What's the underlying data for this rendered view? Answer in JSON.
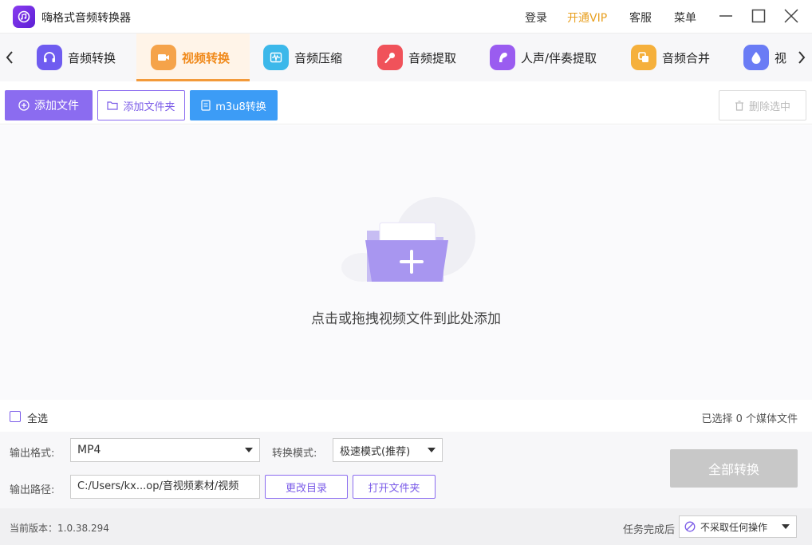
{
  "app": {
    "title": "嗨格式音频转换器",
    "login": "登录",
    "vip": "开通VIP",
    "service": "客服",
    "menu": "菜单"
  },
  "nav": {
    "tabs": [
      {
        "label": "音频转换",
        "icon": "headphones-icon",
        "color": "#6f5cf0"
      },
      {
        "label": "视频转换",
        "icon": "video-camera-icon",
        "color": "#f5a34a"
      },
      {
        "label": "音频压缩",
        "icon": "waveform-icon",
        "color": "#3cb8ea"
      },
      {
        "label": "音频提取",
        "icon": "microphone-icon",
        "color": "#f0525a"
      },
      {
        "label": "人声/伴奏提取",
        "icon": "voice-icon",
        "color": "#9a5cf0"
      },
      {
        "label": "音频合并",
        "icon": "merge-icon",
        "color": "#f5b03c"
      },
      {
        "label": "视",
        "icon": "drop-icon",
        "color": "#6a7cf5"
      }
    ]
  },
  "toolbar": {
    "add_file": "添加文件",
    "add_folder": "添加文件夹",
    "m3u8": "m3u8转换",
    "delete_selected": "删除选中"
  },
  "dropzone": {
    "hint": "点击或拖拽视频文件到此处添加"
  },
  "selection": {
    "select_all": "全选",
    "count_text": "已选择 0 个媒体文件"
  },
  "settings": {
    "format_label": "输出格式:",
    "format_value": "MP4",
    "mode_label": "转换模式:",
    "mode_value": "极速模式(推荐)",
    "path_label": "输出路径:",
    "path_value": "C:/Users/kx...op/音视频素材/视频",
    "change_dir": "更改目录",
    "open_folder": "打开文件夹",
    "convert_all": "全部转换"
  },
  "footer": {
    "version": "当前版本：1.0.38.294",
    "after_label": "任务完成后",
    "after_value": "不采取任何操作"
  },
  "colors": {
    "accent": "#8b6cf0",
    "active_tab": "#f08a1c",
    "blue": "#3c9cf6",
    "vip": "#e8a020"
  }
}
